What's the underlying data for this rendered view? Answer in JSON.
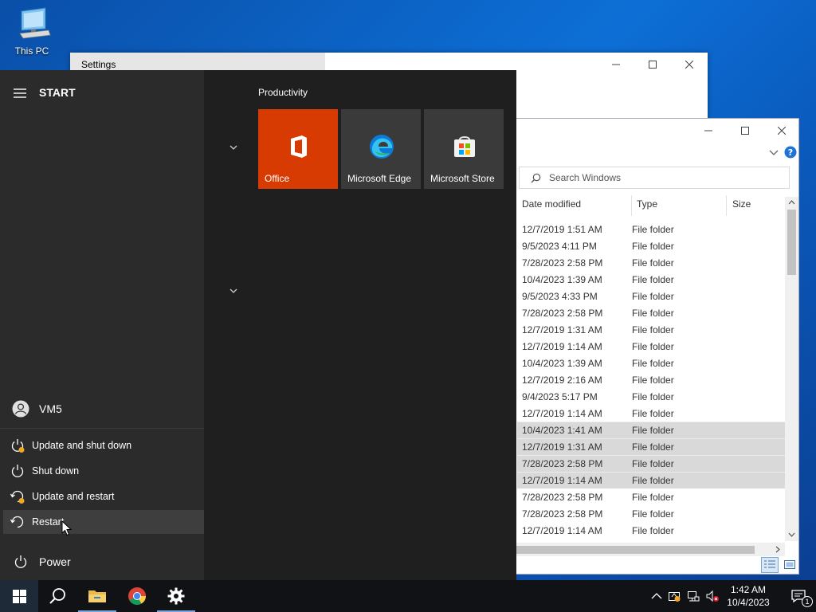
{
  "desktop": {
    "icon_label": "This PC"
  },
  "settings_window": {
    "title": "Settings"
  },
  "explorer": {
    "search_placeholder": "Search Windows",
    "columns": {
      "date": "Date modified",
      "type": "Type",
      "size": "Size"
    },
    "rows": [
      {
        "date": "12/7/2019 1:51 AM",
        "type": "File folder",
        "selected": false
      },
      {
        "date": "9/5/2023 4:11 PM",
        "type": "File folder",
        "selected": false
      },
      {
        "date": "7/28/2023 2:58 PM",
        "type": "File folder",
        "selected": false
      },
      {
        "date": "10/4/2023 1:39 AM",
        "type": "File folder",
        "selected": false
      },
      {
        "date": "9/5/2023 4:33 PM",
        "type": "File folder",
        "selected": false
      },
      {
        "date": "7/28/2023 2:58 PM",
        "type": "File folder",
        "selected": false
      },
      {
        "date": "12/7/2019 1:31 AM",
        "type": "File folder",
        "selected": false
      },
      {
        "date": "12/7/2019 1:14 AM",
        "type": "File folder",
        "selected": false
      },
      {
        "date": "10/4/2023 1:39 AM",
        "type": "File folder",
        "selected": false
      },
      {
        "date": "12/7/2019 2:16 AM",
        "type": "File folder",
        "selected": false
      },
      {
        "date": "9/4/2023 5:17 PM",
        "type": "File folder",
        "selected": false
      },
      {
        "date": "12/7/2019 1:14 AM",
        "type": "File folder",
        "selected": false
      },
      {
        "date": "10/4/2023 1:41 AM",
        "type": "File folder",
        "selected": true
      },
      {
        "date": "12/7/2019 1:31 AM",
        "type": "File folder",
        "selected": true
      },
      {
        "date": "7/28/2023 2:58 PM",
        "type": "File folder",
        "selected": true
      },
      {
        "date": "12/7/2019 1:14 AM",
        "type": "File folder",
        "selected": true
      },
      {
        "date": "7/28/2023 2:58 PM",
        "type": "File folder",
        "selected": false
      },
      {
        "date": "7/28/2023 2:58 PM",
        "type": "File folder",
        "selected": false
      },
      {
        "date": "12/7/2019 1:14 AM",
        "type": "File folder",
        "selected": false
      }
    ]
  },
  "start_menu": {
    "title": "START",
    "user": "VM5",
    "power_label": "Power",
    "power_options": [
      {
        "label": "Update and shut down",
        "icon": "update-power-icon",
        "hover": false
      },
      {
        "label": "Shut down",
        "icon": "power-icon",
        "hover": false
      },
      {
        "label": "Update and restart",
        "icon": "update-restart-icon",
        "hover": false
      },
      {
        "label": "Restart",
        "icon": "restart-icon",
        "hover": true
      }
    ],
    "group_title": "Productivity",
    "tiles": [
      {
        "name": "Office",
        "color": "#d83b01"
      },
      {
        "name": "Microsoft Edge",
        "color": "#3a3a3a"
      },
      {
        "name": "Microsoft Store",
        "color": "#3a3a3a"
      }
    ]
  },
  "taskbar": {
    "time": "1:42 AM",
    "date": "10/4/2023",
    "notification_count": "1"
  },
  "colors": {
    "accent": "#0078d7",
    "office_tile": "#d83b01",
    "taskbar": "#101215"
  }
}
